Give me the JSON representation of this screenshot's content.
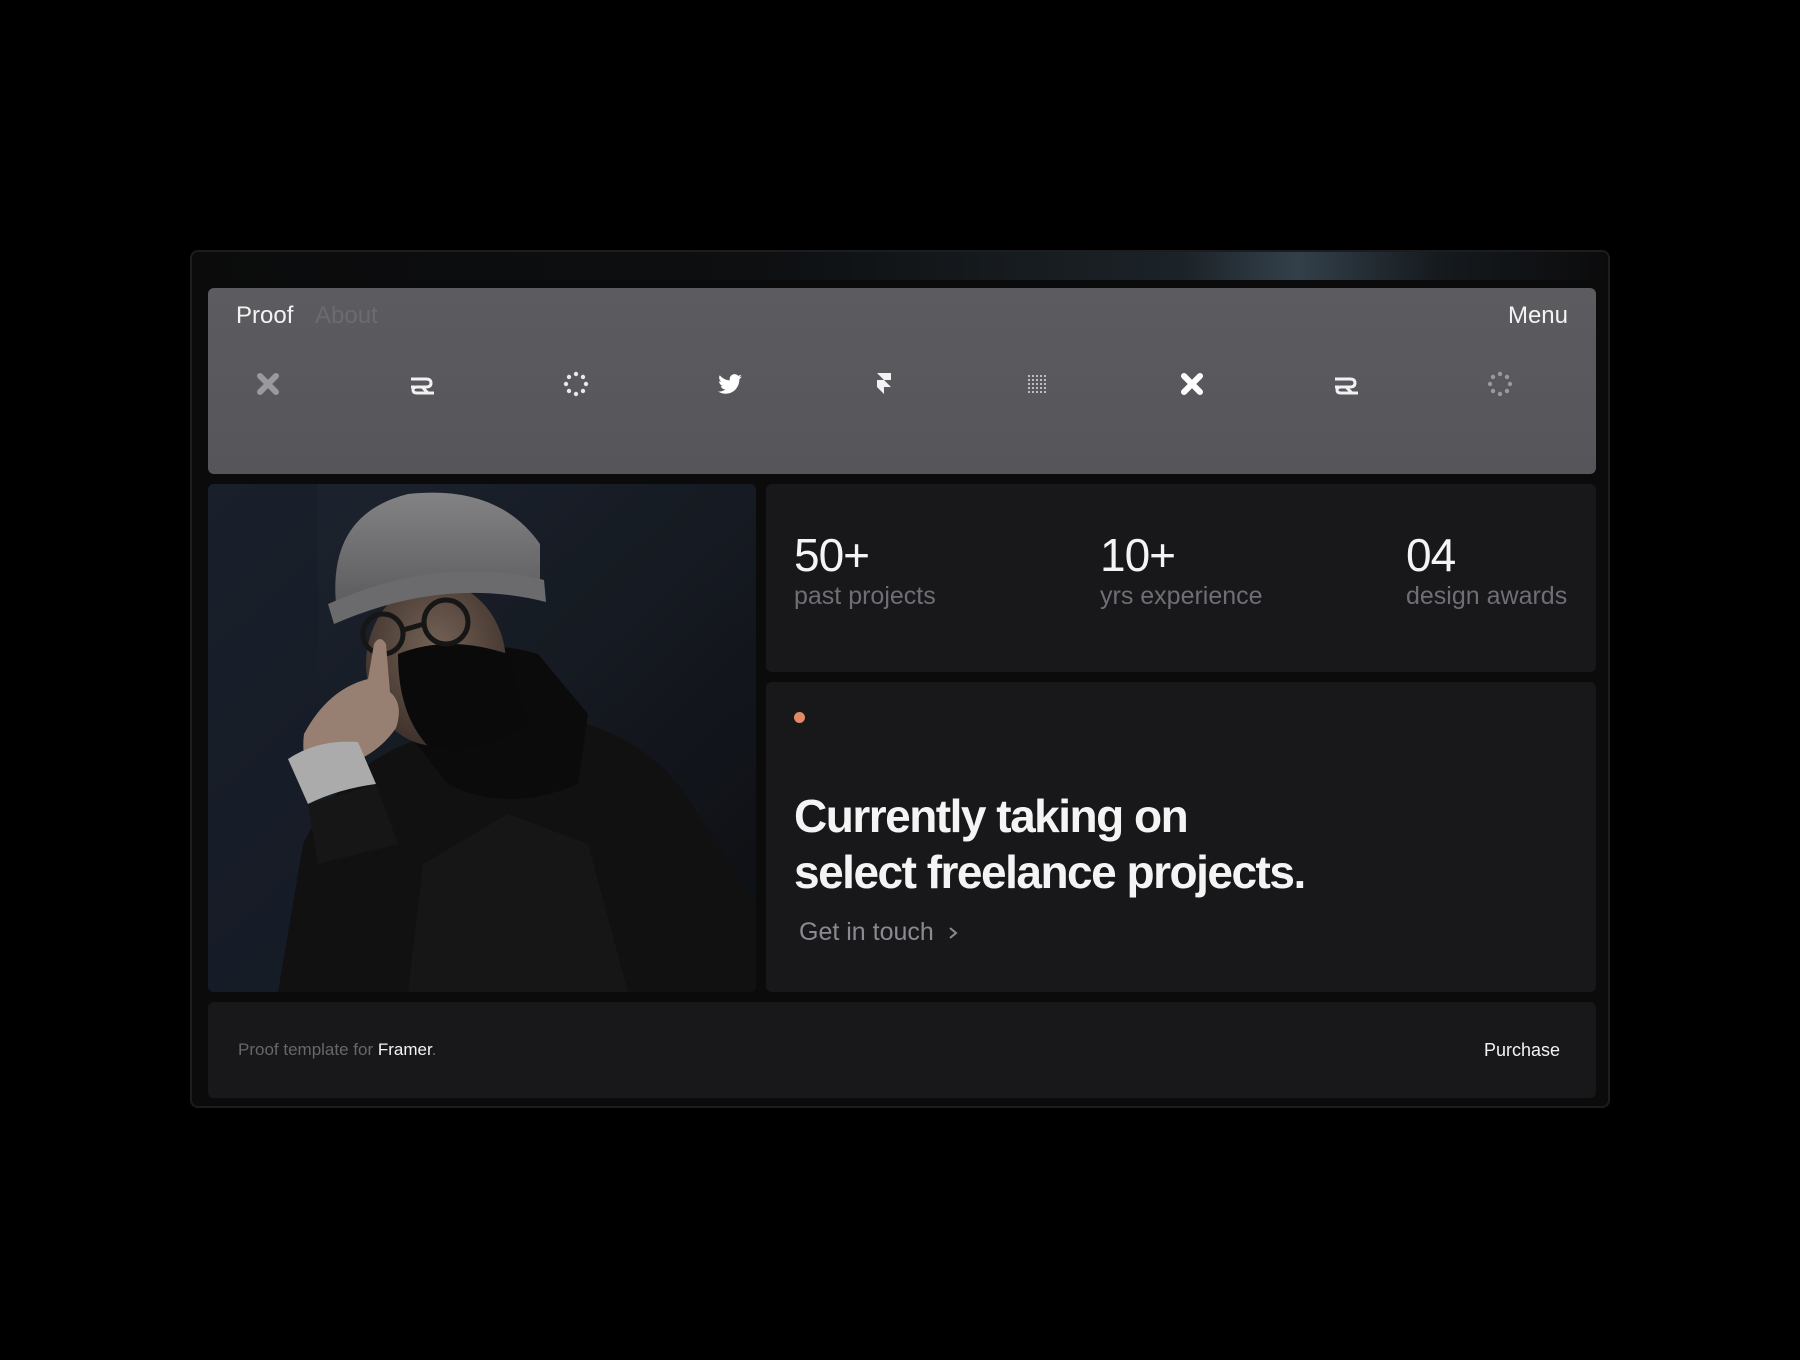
{
  "header": {
    "brand": "Proof",
    "nav_about": "About",
    "menu_label": "Menu",
    "logos": [
      {
        "icon": "x-mark-icon",
        "color": "#9a9a9e"
      },
      {
        "icon": "knot-logo-icon",
        "color": "#f2f2f2"
      },
      {
        "icon": "dotted-circle-icon",
        "color": "#e8e8e8"
      },
      {
        "icon": "twitter-bird-icon",
        "color": "#ffffff"
      },
      {
        "icon": "framer-logo-icon",
        "color": "#f2f2f2"
      },
      {
        "icon": "dot-grid-icon",
        "color": "#bdbdc2"
      },
      {
        "icon": "x-mark-icon",
        "color": "#ffffff"
      },
      {
        "icon": "knot-logo-icon",
        "color": "#f2f2f2"
      },
      {
        "icon": "dotted-circle-icon",
        "color": "#9a9a9e"
      }
    ]
  },
  "stats": [
    {
      "value": "50+",
      "label": "past projects"
    },
    {
      "value": "10+",
      "label": "yrs experience"
    },
    {
      "value": "04",
      "label": "design awards"
    }
  ],
  "cta": {
    "status_color": "#e08a66",
    "headline_line1": "Currently taking on",
    "headline_line2": "select freelance projects.",
    "link_label": "Get in touch"
  },
  "footer": {
    "prefix": "Proof template for",
    "link": "Framer",
    "suffix": ".",
    "purchase_label": "Purchase"
  }
}
